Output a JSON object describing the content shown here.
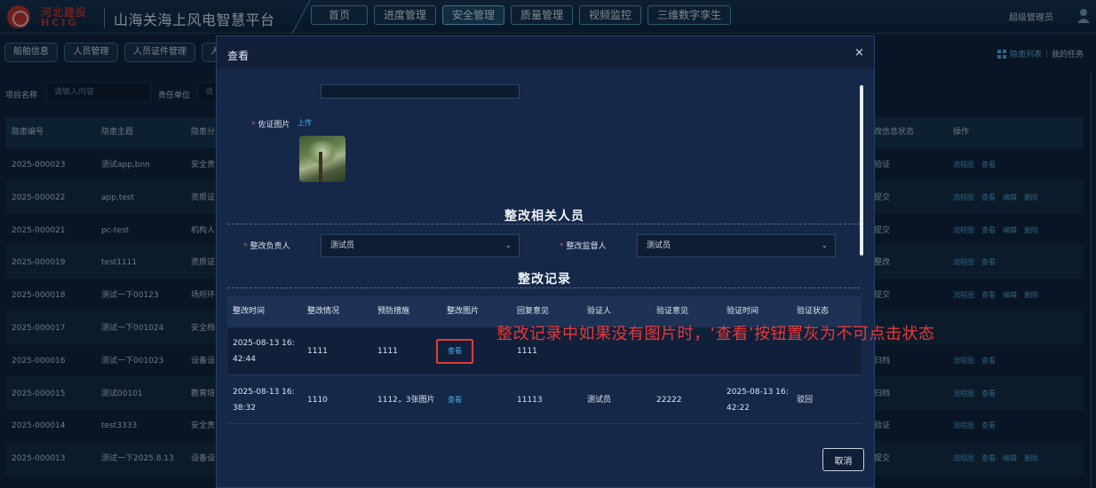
{
  "header": {
    "brand_cn": "河北建投",
    "brand_en": "HCIG",
    "app_title": "山海关海上风电智慧平台",
    "nav": [
      "首页",
      "进度管理",
      "安全管理",
      "质量管理",
      "视频监控",
      "三维数字孪生"
    ],
    "active_nav": "安全管理",
    "user": "超级管理员"
  },
  "subtabs": [
    "船舶信息",
    "人员管理",
    "人员证件管理",
    "人"
  ],
  "right_links": {
    "hazard_list": "隐患列表",
    "divider": "|",
    "my_tasks": "我的任务"
  },
  "filters": {
    "project_label": "项目名称",
    "project_placeholder": "请输入内容",
    "unit_label": "责任单位",
    "unit_placeholder": "请"
  },
  "table": {
    "headers": {
      "id": "隐患编号",
      "topic": "隐患主题",
      "category": "隐患分",
      "status": "改信息状态",
      "ops": "操作"
    },
    "rows": [
      {
        "id": "2025-000023",
        "topic": "测试app,bnn",
        "category": "安全责",
        "status": "验证",
        "ops": [
          "流程图",
          "查看"
        ]
      },
      {
        "id": "2025-000022",
        "topic": "app,test",
        "category": "资质证",
        "status": "提交",
        "ops": [
          "流程图",
          "查看",
          "编辑",
          "删除"
        ]
      },
      {
        "id": "2025-000021",
        "topic": "pc-test",
        "category": "机构人",
        "status": "提交",
        "ops": [
          "流程图",
          "查看",
          "编辑",
          "删除"
        ]
      },
      {
        "id": "2025-000019",
        "topic": "test1111",
        "category": "资质证",
        "status": "整改",
        "ops": [
          "流程图",
          "查看"
        ]
      },
      {
        "id": "2025-000018",
        "topic": "测试一下00123",
        "category": "场所环",
        "status": "提交",
        "ops": [
          "流程图",
          "查看",
          "编辑",
          "删除"
        ]
      },
      {
        "id": "2025-000017",
        "topic": "测试一下001024",
        "category": "安全档",
        "status": "",
        "ops": []
      },
      {
        "id": "2025-000016",
        "topic": "测试一下001023",
        "category": "设备设",
        "status": "归档",
        "ops": [
          "流程图",
          "查看"
        ]
      },
      {
        "id": "2025-000015",
        "topic": "测试00101",
        "category": "教育培",
        "status": "归档",
        "ops": [
          "流程图",
          "查看"
        ]
      },
      {
        "id": "2025-000014",
        "topic": "test3333",
        "category": "安全责",
        "status": "验证",
        "ops": [
          "流程图",
          "查看"
        ]
      },
      {
        "id": "2025-000013",
        "topic": "测试一下2025.8.13",
        "category": "设备设",
        "status": "提交",
        "ops": [
          "流程图",
          "查看",
          "编辑",
          "删除"
        ]
      }
    ]
  },
  "modal": {
    "title": "查看",
    "close": "×",
    "evidence_label": "佐证图片",
    "required_mark": "*",
    "upload": "上传",
    "personnel_title": "整改相关人员",
    "owner_label": "整改负责人",
    "owner_value": "测试员",
    "supervisor_label": "整改监督人",
    "supervisor_value": "测试员",
    "records_title": "整改记录",
    "records_headers": [
      "整改时间",
      "整改情况",
      "预防措施",
      "整改图片",
      "回复意见",
      "验证人",
      "验证意见",
      "验证时间",
      "验证状态"
    ],
    "records": [
      {
        "time": "2025-08-13 16:42:44",
        "situation": "1111",
        "prevention": "1111",
        "image": "查看",
        "reply": "1111",
        "verifier": "",
        "opinion": "",
        "verify_time": "",
        "status": ""
      },
      {
        "time": "2025-08-13 16:38:32",
        "situation": "1110",
        "prevention": "1112，3张图片",
        "image": "查看",
        "reply": "11113",
        "verifier": "测试员",
        "opinion": "22222",
        "verify_time": "2025-08-13 16:42:22",
        "status": "驳回"
      }
    ],
    "cancel": "取消"
  },
  "annotation": "整改记录中如果没有图片时，‘查看’按钮置灰为不可点击状态",
  "colors": {
    "accent": "#4aaee6",
    "annotation": "#e53a3a",
    "brand": "#c8322a"
  }
}
